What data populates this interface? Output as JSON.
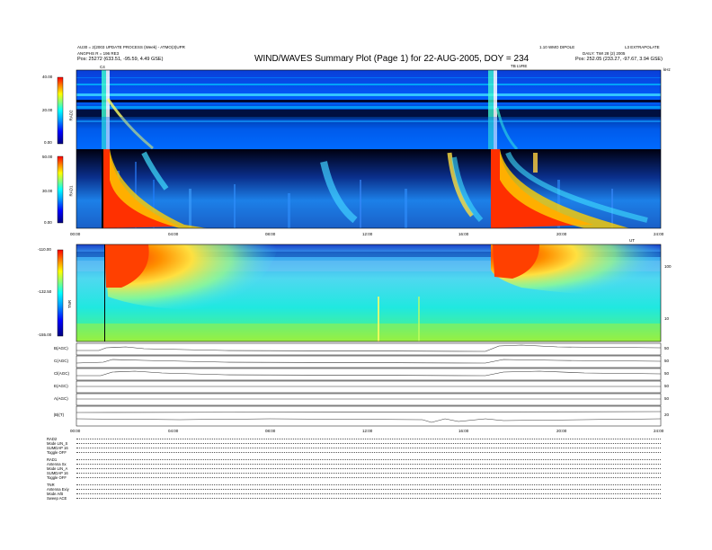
{
  "header": {
    "title": "WIND/WAVES Summary Plot (Page 1) for 22-AUG-2005, DOY = 234",
    "left_line1": "AU30 = 2(2003 UPDATE PROCESS (Week) - ATMO(3)UPR",
    "left_line2": "ANGPHS R = 196 RE3",
    "left_pos": "Pos:   25272 (633.51, -95.59, 4.49 GSE)",
    "right_line1": "L3 EXTRAPOLATE",
    "right_line2": "DAILY: TWI 28 (2) 2005",
    "right_pos": "Pos:   252.05 (233.27, -97.67, 3.94 GSE)",
    "center_right": "1.10 WMO DIPOLE",
    "marker_c": "C4",
    "marker_tb": "TB LVRE",
    "marker_top_right": "kHz"
  },
  "chart_data": [
    {
      "type": "heatmap",
      "name": "RAD2",
      "ylabel": "RAD2",
      "colorbar_ticks": [
        "40.00",
        "20.00",
        "0.00"
      ]
    },
    {
      "type": "heatmap",
      "name": "RAD1",
      "ylabel": "RAD1",
      "colorbar_ticks": [
        "50.00",
        "30.00",
        "0.00"
      ],
      "x_ticks": [
        "00:00",
        "04:00",
        "08:00",
        "12:00",
        "16:00",
        "20:00",
        "24:00"
      ],
      "x_unit": "UT"
    },
    {
      "type": "heatmap",
      "name": "TNR",
      "ylabel": "TNR",
      "colorbar_ticks": [
        "-110.00",
        "-132.50",
        "-155.00"
      ],
      "right_ticks": [
        "100",
        "10"
      ]
    },
    {
      "type": "line",
      "series": [
        {
          "name": "B(AGC)",
          "right": "50"
        },
        {
          "name": "C(AGC)",
          "right": "50"
        },
        {
          "name": "Cl(AGC)",
          "right": "50"
        },
        {
          "name": "E(AGC)",
          "right": "50"
        },
        {
          "name": "A(AGC)",
          "right": "50"
        },
        {
          "name": "|B|(T)",
          "right": "20"
        }
      ],
      "x_ticks": [
        "00:00",
        "04:00",
        "08:00",
        "12:00",
        "16:00",
        "20:00",
        "24:00"
      ]
    }
  ],
  "footer_legend": [
    "RAD2",
    "Mode  LIN_S",
    "SUMDAP  16",
    "Toggle  OFF",
    "RAD1",
    "Antenna  Sx",
    "Mode  LIN_A",
    "SUMDAP  16",
    "Toggle  OFF",
    "TNR",
    "Antenna  Exiy",
    "Mode  A/B",
    "Sweep  ACE"
  ]
}
